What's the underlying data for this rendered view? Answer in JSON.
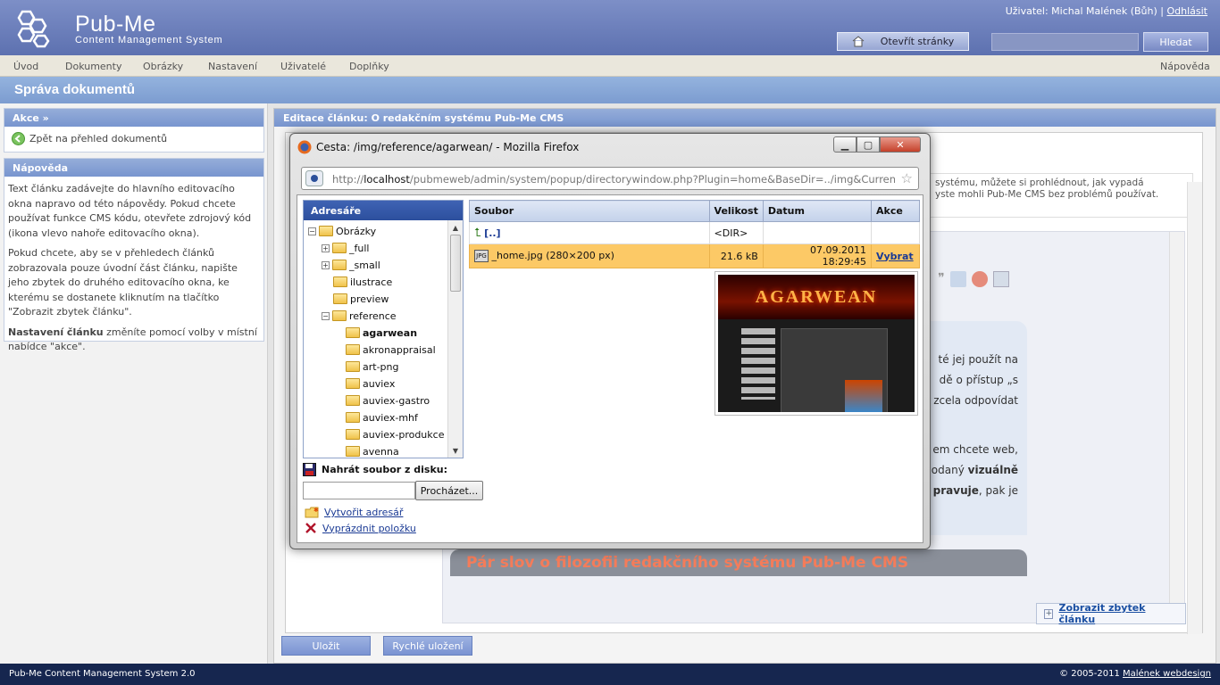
{
  "header": {
    "app_name": "Pub-Me",
    "app_subtitle": "Content Management System",
    "user_prefix": "Uživatel: Michal Malének (Bůh) |",
    "logout": "Odhlásit",
    "open_site": "Otevřít stránky",
    "search_placeholder": "",
    "search_button": "Hledat"
  },
  "menu": {
    "items": [
      "Úvod",
      "Dokumenty",
      "Obrázky",
      "Nastavení",
      "Uživatelé",
      "Doplňky"
    ],
    "help": "Nápověda"
  },
  "page_title": "Správa dokumentů",
  "sidebar": {
    "actions_title": "Akce »",
    "back_link": "Zpět na přehled dokumentů",
    "help_title": "Nápověda",
    "help_p1": "Text článku zadávejte do hlavního editovacího okna napravo od této nápovědy. Pokud chcete používat funkce CMS kódu, otevřete zdrojový kód (ikona vlevo nahoře editovacího okna).",
    "help_p2": "Pokud chcete, aby se v přehledech článků zobrazovala pouze úvodní část článku, napište jeho zbytek do druhého editovacího okna, ke kterému se dostanete kliknutím na tlačítko \"Zobrazit zbytek článku\".",
    "help_p3_bold": "Nastavení článku",
    "help_p3_rest": " změníte pomocí volby v místní nabídce \"akce\"."
  },
  "main": {
    "title": "Editace článku: O redakčním systému Pub-Me CMS",
    "desc_line1": "systému, můžete si prohlédnout, jak vypadá",
    "desc_line2": "yste mohli Pub-Me CMS bez problémů používat.",
    "article_lines": [
      "té jej použít na",
      "dě o přístup „s",
      "zcela odpovídat",
      "em chcete web,",
      "odaný",
      "vizuálně",
      "pravuje",
      ", pak je"
    ],
    "heading2": "Pár slov o filozofii redakčního systému Pub-Me CMS",
    "show_rest": "Zobrazit zbytek článku",
    "save": "Uložit",
    "quick_save": "Rychlé uložení"
  },
  "popup": {
    "title": "Cesta: /img/reference/agarwean/ - Mozilla Firefox",
    "url_prefix": "http://",
    "url_host": "localhost",
    "url_rest": "/pubmeweb/admin/system/popup/directorywindow.php?Plugin=home&BaseDir=../img&CurrentDir=/",
    "tree_title": "Adresáře",
    "tree": [
      "Obrázky",
      "_full",
      "_small",
      "ilustrace",
      "preview",
      "reference",
      "agarwean",
      "akronappraisal",
      "art-png",
      "auviex",
      "auviex-gastro",
      "auviex-mhf",
      "auviex-produkce",
      "avenna"
    ],
    "columns": [
      "Soubor",
      "Velikost",
      "Datum",
      "Akce"
    ],
    "rows": [
      {
        "name": "[..]",
        "size": "<DIR>",
        "date": "",
        "action": ""
      },
      {
        "name": "_home.jpg (280×200 px)",
        "size": "21.6 kB",
        "date": "07.09.2011 18:29:45",
        "action": "Vybrat"
      }
    ],
    "upload_label": "Nahrát soubor z disku:",
    "browse": "Procházet...",
    "create_dir": "Vytvořit adresář",
    "clear_item": "Vyprázdnit položku",
    "preview_text": "AGARWEAN"
  },
  "footer": {
    "left": "Pub-Me Content Management System 2.0",
    "right_prefix": "© 2005-2011",
    "right_link": "Malének webdesign"
  },
  "colors": {
    "header": "#6b7fbd",
    "accent": "#7c9cd0",
    "footer": "#16264f",
    "selected_row": "#fcc966"
  }
}
